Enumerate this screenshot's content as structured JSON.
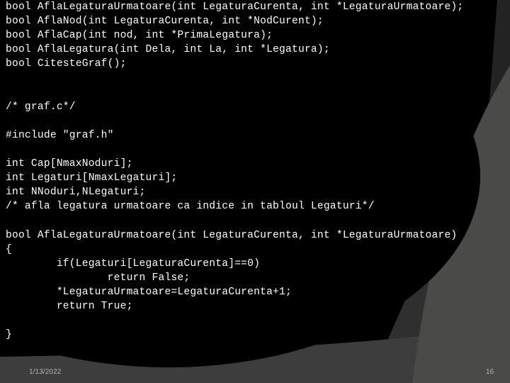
{
  "slide": {
    "background_colors": {
      "base": "#000000",
      "band_top_right": "#232323",
      "wedge_dark": "#2f2f2f",
      "footer_band": "#3d3d3d",
      "wedge_light": "#4a4a48",
      "ellipse": "#000000"
    },
    "code": {
      "language": "c",
      "text_color": "#ffffff",
      "lines": [
        "bool AflaLegaturaUrmatoare(int LegaturaCurenta, int *LegaturaUrmatoare);",
        "bool AflaNod(int LegaturaCurenta, int *NodCurent);",
        "bool AflaCap(int nod, int *PrimaLegatura);",
        "bool AflaLegatura(int Dela, int La, int *Legatura);",
        "bool CitesteGraf();",
        "",
        "",
        "/* graf.c*/",
        "",
        "#include \"graf.h\"",
        "",
        "int Cap[NmaxNoduri];",
        "int Legaturi[NmaxLegaturi];",
        "int NNoduri,NLegaturi;",
        "/* afla legatura urmatoare ca indice in tabloul Legaturi*/",
        "",
        "bool AflaLegaturaUrmatoare(int LegaturaCurenta, int *LegaturaUrmatoare)",
        "{",
        "        if(Legaturi[LegaturaCurenta]==0)",
        "                return False;",
        "        *LegaturaUrmatoare=LegaturaCurenta+1;",
        "        return True;",
        "",
        "}"
      ]
    },
    "footer": {
      "date": "1/13/2022",
      "slide_number": "16",
      "text_color": "#b4b4b4"
    }
  }
}
